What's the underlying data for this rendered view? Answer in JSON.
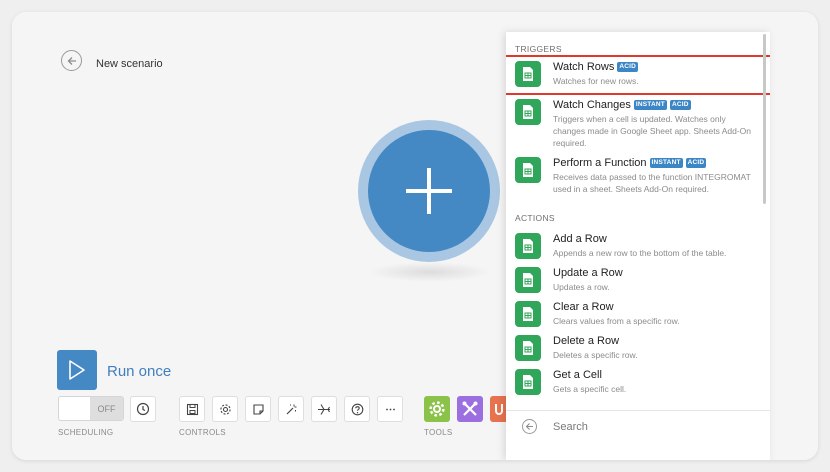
{
  "scenario": {
    "title": "New scenario"
  },
  "run": {
    "label": "Run once"
  },
  "scheduling": {
    "toggle_state": "OFF",
    "section_label": "SCHEDULING"
  },
  "controls": {
    "section_label": "CONTROLS"
  },
  "tools": {
    "section_label": "TOOLS"
  },
  "module_panel": {
    "triggers_label": "TRIGGERS",
    "actions_label": "ACTIONS",
    "triggers": [
      {
        "title": "Watch Rows",
        "badges": [
          "ACID"
        ],
        "description": "Watches for new rows.",
        "selected": true
      },
      {
        "title": "Watch Changes",
        "badges": [
          "INSTANT",
          "ACID"
        ],
        "description": "Triggers when a cell is updated. Watches only changes made in Google Sheet app. Sheets Add-On required.",
        "selected": false
      },
      {
        "title": "Perform a Function",
        "badges": [
          "INSTANT",
          "ACID"
        ],
        "description": "Receives data passed to the function INTEGROMAT used in a sheet. Sheets Add-On required.",
        "selected": false
      }
    ],
    "actions": [
      {
        "title": "Add a Row",
        "description": "Appends a new row to the bottom of the table."
      },
      {
        "title": "Update a Row",
        "description": "Updates a row."
      },
      {
        "title": "Clear a Row",
        "description": "Clears values from a specific row."
      },
      {
        "title": "Delete a Row",
        "description": "Deletes a specific row."
      },
      {
        "title": "Get a Cell",
        "description": "Gets a specific cell."
      }
    ],
    "search_placeholder": "Search"
  },
  "colors": {
    "accent": "#4488c4",
    "sheets_green": "#2fa65a",
    "badge_blue": "#3d86c6",
    "highlight_red": "#e0392b",
    "tool_green": "#8bc34a",
    "tool_purple": "#9c6fe0",
    "tool_orange": "#e8734f"
  },
  "icons": {
    "back": "arrow-left-circle-icon",
    "add_module": "plus-icon",
    "run": "play-icon",
    "scheduling": "clock-icon",
    "controls": [
      "save-icon",
      "gear-icon",
      "note-icon",
      "magic-wand-icon",
      "airplane-icon",
      "help-icon",
      "more-icon"
    ],
    "tools": [
      "gear-icon",
      "tools-icon",
      "text-parser-icon"
    ],
    "module": "google-sheets-icon",
    "search_back": "arrow-left-circle-icon"
  }
}
